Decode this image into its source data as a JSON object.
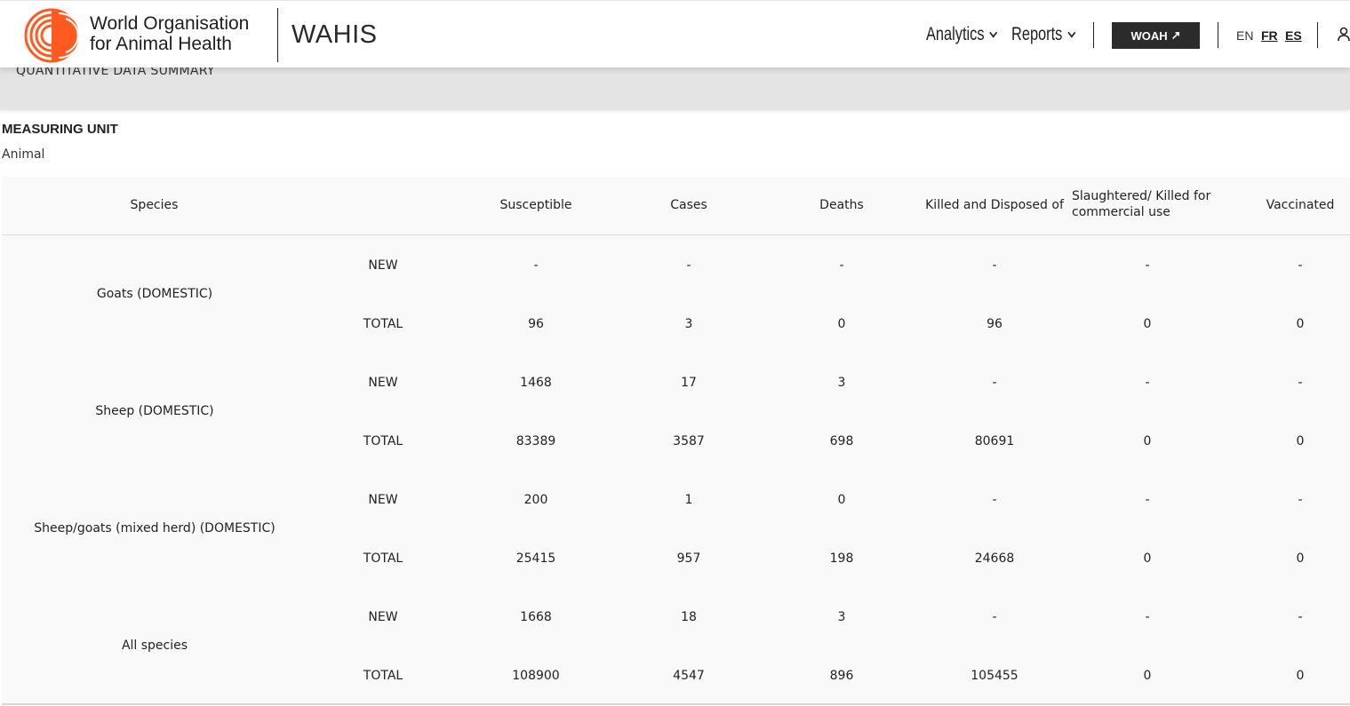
{
  "header": {
    "org_line1": "World Organisation",
    "org_line2": "for Animal Health",
    "app_name": "WAHIS",
    "nav": {
      "analytics": "Analytics",
      "reports": "Reports",
      "woah_button": "WOAH",
      "woah_arrow": "↗"
    },
    "languages": [
      "EN",
      "FR",
      "ES"
    ],
    "colors": {
      "logo_orange": "#ff5a1f",
      "button_dark": "#2b2b2b"
    }
  },
  "section": {
    "title": "QUANTITATIVE DATA SUMMARY"
  },
  "measuring_unit": {
    "label": "MEASURING UNIT",
    "value": "Animal"
  },
  "table": {
    "columns": {
      "species": "Species",
      "susceptible": "Susceptible",
      "cases": "Cases",
      "deaths": "Deaths",
      "killed": "Killed and Disposed of",
      "slaughtered_line1": "Slaughtered/ Killed for",
      "slaughtered_line2": "commercial use",
      "vaccinated": "Vaccinated"
    },
    "rows": [
      {
        "species": "Goats (DOMESTIC)",
        "new": {
          "label": "NEW",
          "values": [
            "-",
            "-",
            "-",
            "-",
            "-",
            "-"
          ]
        },
        "total": {
          "label": "TOTAL",
          "values": [
            "96",
            "3",
            "0",
            "96",
            "0",
            "0"
          ]
        }
      },
      {
        "species": "Sheep (DOMESTIC)",
        "new": {
          "label": "NEW",
          "values": [
            "1468",
            "17",
            "3",
            "-",
            "-",
            "-"
          ]
        },
        "total": {
          "label": "TOTAL",
          "values": [
            "83389",
            "3587",
            "698",
            "80691",
            "0",
            "0"
          ]
        }
      },
      {
        "species": "Sheep/goats (mixed herd) (DOMESTIC)",
        "new": {
          "label": "NEW",
          "values": [
            "200",
            "1",
            "0",
            "-",
            "-",
            "-"
          ]
        },
        "total": {
          "label": "TOTAL",
          "values": [
            "25415",
            "957",
            "198",
            "24668",
            "0",
            "0"
          ]
        }
      },
      {
        "species": "All species",
        "new": {
          "label": "NEW",
          "values": [
            "1668",
            "18",
            "3",
            "-",
            "-",
            "-"
          ]
        },
        "total": {
          "label": "TOTAL",
          "values": [
            "108900",
            "4547",
            "896",
            "105455",
            "0",
            "0"
          ]
        }
      }
    ]
  }
}
